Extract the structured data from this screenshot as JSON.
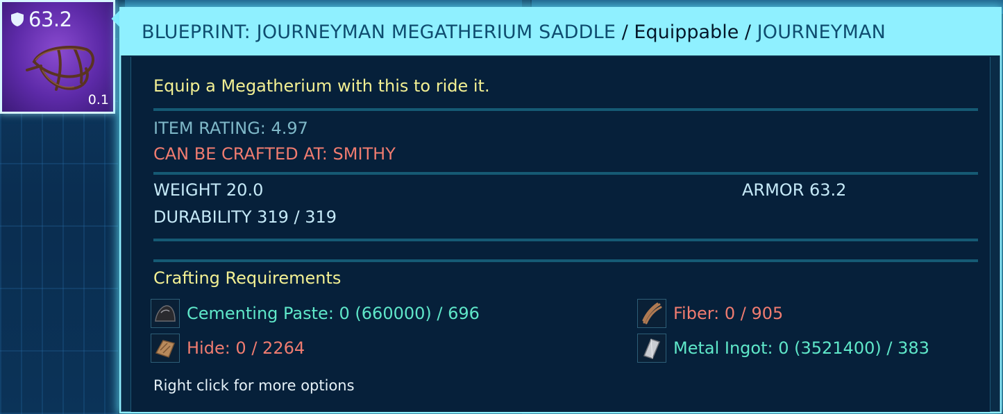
{
  "slot": {
    "armor_value": "63.2",
    "weight": "0.1",
    "icon": "megatherium-saddle-icon"
  },
  "tooltip": {
    "title_name": "BLUEPRINT: JOURNEYMAN MEGATHERIUM SADDLE",
    "title_sep1": " / ",
    "title_type": "Equippable",
    "title_sep2": " / ",
    "title_tier": "JOURNEYMAN",
    "description": "Equip a Megatherium with this to ride it.",
    "item_rating": "ITEM RATING: 4.97",
    "crafted_at": "CAN BE CRAFTED AT: SMITHY",
    "weight": "WEIGHT 20.0",
    "armor": "ARMOR 63.2",
    "durability": "DURABILITY 319 / 319",
    "crafting_header": "Crafting Requirements",
    "requirements": [
      {
        "text": "Cementing Paste: 0 (660000) / 696",
        "status": "ok",
        "icon": "cementing-paste-icon"
      },
      {
        "text": "Fiber: 0 / 905",
        "status": "missing",
        "icon": "fiber-icon"
      },
      {
        "text": "Hide: 0 / 2264",
        "status": "missing",
        "icon": "hide-icon"
      },
      {
        "text": "Metal Ingot: 0 (3521400) / 383",
        "status": "ok",
        "icon": "metal-ingot-icon"
      }
    ],
    "hint": "Right click for more options"
  },
  "colors": {
    "title_bar": "#8ff0ff",
    "ok": "#5fe7c9",
    "missing": "#f07c70",
    "heading": "#f3f093"
  }
}
